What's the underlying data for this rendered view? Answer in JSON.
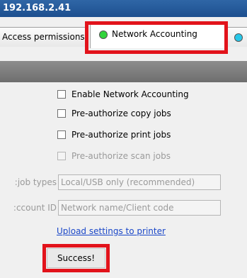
{
  "window": {
    "title": "192.168.2.41"
  },
  "tabs": [
    {
      "label": "Access permissions",
      "active": false
    },
    {
      "label": "Network Accounting",
      "active": true,
      "status_color": "#31d43b"
    },
    {
      "label": "",
      "active": false,
      "status_color": "#27c7e8"
    }
  ],
  "options": [
    {
      "label": "Enable Network Accounting",
      "checked": false,
      "enabled": true
    },
    {
      "label": "Pre-authorize copy jobs",
      "checked": false,
      "enabled": true
    },
    {
      "label": "Pre-authorize print jobs",
      "checked": false,
      "enabled": true
    },
    {
      "label": "Pre-authorize scan jobs",
      "checked": false,
      "enabled": false
    }
  ],
  "fields": {
    "job_types": {
      "label": "job types:",
      "value": "Local/USB only (recommended)"
    },
    "account_id": {
      "label": "ccount ID:",
      "value": "Network name/Client code"
    }
  },
  "upload_link": "Upload settings to printer",
  "status": "Success!",
  "highlight_color": "#e2131b"
}
